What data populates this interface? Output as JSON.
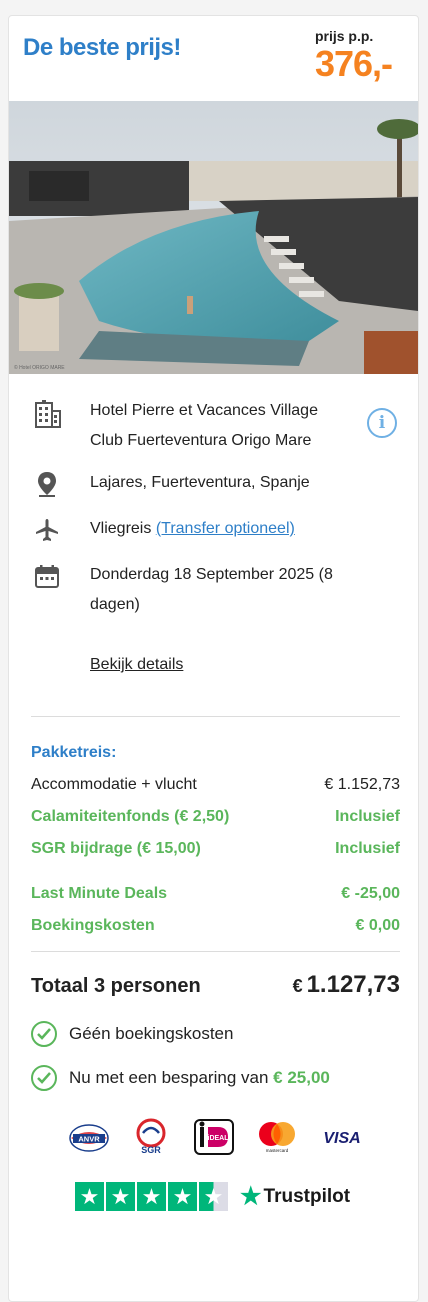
{
  "header": {
    "title": "De beste prijs!",
    "price_label": "prijs p.p.",
    "price_value": "376,-"
  },
  "hotel": {
    "name": "Hotel Pierre et Vacances Village Club Fuerteventura Origo Mare",
    "location": "Lajares, Fuerteventura, Spanje",
    "travel_type": "Vliegreis",
    "transfer_link": "(Transfer optioneel)",
    "date": "Donderdag 18 September 2025 (8 dagen)",
    "details_link": "Bekijk details",
    "photo_credit": "© Hotel ORIGO MARE"
  },
  "package": {
    "title": "Pakketreis:",
    "lines": [
      {
        "label": "Accommodatie + vlucht",
        "value": "€ 1.152,73"
      },
      {
        "label": "Calamiteitenfonds (€ 2,50)",
        "value": "Inclusief"
      },
      {
        "label": "SGR bijdrage (€ 15,00)",
        "value": "Inclusief"
      },
      {
        "label": "Last Minute Deals",
        "value": "€ -25,00"
      },
      {
        "label": "Boekingskosten",
        "value": "€ 0,00"
      }
    ]
  },
  "total": {
    "label": "Totaal 3 personen",
    "currency": "€",
    "value": "1.127,73"
  },
  "benefits": {
    "no_fees": "Géén boekingskosten",
    "savings_text": "Nu met een besparing van",
    "savings_amount": "€ 25,00"
  },
  "logos": {
    "anvr": "ANVR",
    "sgr": "SGR",
    "ideal": "iDEAL",
    "mastercard": "mastercard",
    "visa": "VISA"
  },
  "trustpilot": {
    "name": "Trustpilot",
    "rating_stars": 4.5
  },
  "colors": {
    "brand_blue": "#2e7fc8",
    "price_orange": "#f58220",
    "green": "#5ab65b",
    "trustpilot_green": "#00b67a"
  }
}
